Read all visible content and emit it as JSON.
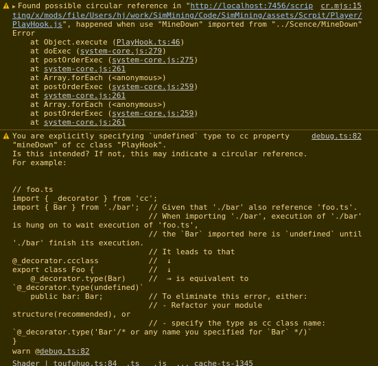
{
  "entry1": {
    "line1_prefix": "Found possible circular reference in \"",
    "url_a": "http://localhost:7456/scrip",
    "source": "cr.mjs:15",
    "url_b": "ting/x/mods/file/Users/hj/work/SimMining/Code/SimMining/assets/Scrpit/Player/",
    "url_c": "PlayHook.js",
    "line3_suffix": "\", happened when use \"MineDown\" imported from \"../Scence/MineDown\"",
    "error_label": "Error",
    "stack": [
      {
        "pre": "at Object.execute (",
        "link": "PlayHook.ts:46",
        "post": ")"
      },
      {
        "pre": "at doExec (",
        "link": "system-core.js:279",
        "post": ")"
      },
      {
        "pre": "at postOrderExec (",
        "link": "system-core.js:275",
        "post": ")"
      },
      {
        "pre": "at ",
        "link": "system-core.js:261",
        "post": ""
      },
      {
        "pre": "at Array.forEach (<anonymous>)",
        "link": "",
        "post": ""
      },
      {
        "pre": "at postOrderExec (",
        "link": "system-core.js:259",
        "post": ")"
      },
      {
        "pre": "at ",
        "link": "system-core.js:261",
        "post": ""
      },
      {
        "pre": "at Array.forEach (<anonymous>)",
        "link": "",
        "post": ""
      },
      {
        "pre": "at postOrderExec (",
        "link": "system-core.js:259",
        "post": ")"
      },
      {
        "pre": "at ",
        "link": "system-core.js:261",
        "post": ""
      }
    ]
  },
  "entry2": {
    "source": "debug.ts:82",
    "lines": [
      "You are explicitly specifying `undefined` type to cc property",
      "\"mineDown\" of cc class \"PlayHook\".",
      "Is this intended? If not, this may indicate a circular reference.",
      "For example:",
      "",
      "",
      "// foo.ts",
      "import { _decorator } from 'cc';",
      "import { Bar } from './bar';  // Given that './bar' also reference 'foo.ts'.",
      "                              // When importing './bar', execution of './bar'",
      "is hung on to wait execution of 'foo.ts',",
      "                              // the `Bar` imported here is `undefined` until",
      "'./bar' finish its execution.",
      "                              // It leads to that",
      "@_decorator.ccclass           //  ↓",
      "export class Foo {            //  ↓",
      "    @_decorator.type(Bar)     //  → is equivalent to",
      "`@_decorator.type(undefined)`",
      "    public bar: Bar;          // To eliminate this error, either:",
      "                              // - Refactor your module",
      "structure(recommended), or",
      "                              // - specify the type as cc class name:",
      "`@_decorator.type('Bar'/* or any name you specified for `Bar` */)`",
      "}"
    ]
  },
  "footer": {
    "level": "warn",
    "at": "@",
    "source": "debug.ts:82"
  },
  "partial_line": "Shader | toufuhuo.ts:84  .ts   .js  ... cache-ts-1345"
}
